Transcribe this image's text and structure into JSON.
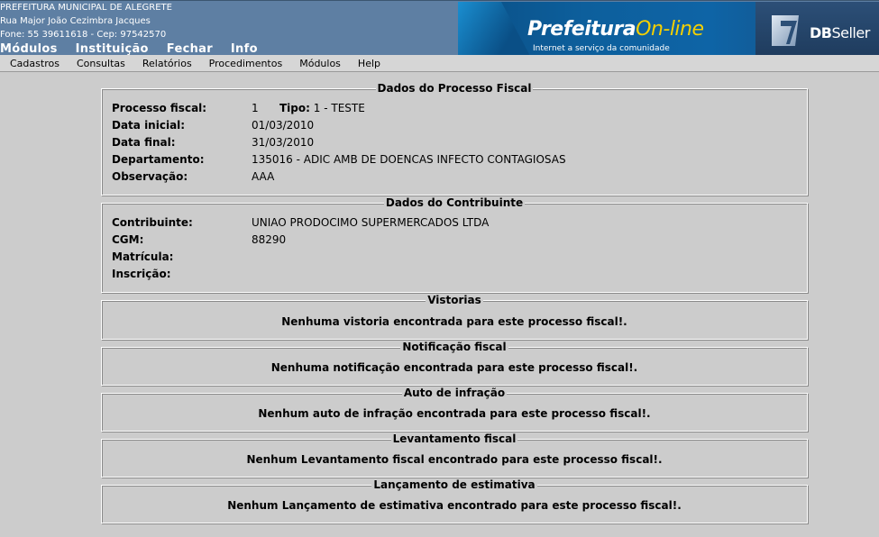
{
  "header": {
    "org_name": "PREFEITURA MUNICIPAL DE ALEGRETE",
    "address": "Rua Major João Cezimbra Jacques",
    "phone": "Fone: 55 39611618  -  Cep: 97542570",
    "menu": [
      "Módulos",
      "Instituição",
      "Fechar",
      "Info"
    ],
    "brand_prefix": "Prefeitura",
    "brand_suffix": "On-line",
    "brand_tagline": "Internet a serviço da comunidade",
    "dbseller_db": "DB",
    "dbseller_seller": "Seller"
  },
  "menubar": [
    "Cadastros",
    "Consultas",
    "Relatórios",
    "Procedimentos",
    "Módulos",
    "Help"
  ],
  "processo": {
    "legend": "Dados do Processo Fiscal",
    "processo_label": "Processo fiscal:",
    "processo_value": "1",
    "tipo_label": "Tipo:",
    "tipo_value": "1 - TESTE",
    "data_inicial_label": "Data inicial:",
    "data_inicial_value": "01/03/2010",
    "data_final_label": "Data final:",
    "data_final_value": "31/03/2010",
    "departamento_label": "Departamento:",
    "departamento_value": "135016 - ADIC AMB DE DOENCAS INFECTO CONTAGIOSAS",
    "observacao_label": "Observação:",
    "observacao_value": "AAA"
  },
  "contribuinte": {
    "legend": "Dados do Contribuinte",
    "contribuinte_label": "Contribuinte:",
    "contribuinte_value": "UNIAO PRODOCIMO SUPERMERCADOS LTDA",
    "cgm_label": "CGM:",
    "cgm_value": "88290",
    "matricula_label": "Matrícula:",
    "inscricao_label": "Inscrição:"
  },
  "vistorias": {
    "legend": "Vistorias",
    "message": "Nenhuma vistoria encontrada para este processo fiscal!."
  },
  "notificacao": {
    "legend": "Notificação fiscal",
    "message": "Nenhuma notificação encontrada para este processo fiscal!."
  },
  "auto": {
    "legend": "Auto de infração",
    "message": "Nenhum auto de infração encontrada para este processo fiscal!."
  },
  "levantamento": {
    "legend": "Levantamento fiscal",
    "message": "Nenhum Levantamento fiscal encontrado para este processo fiscal!."
  },
  "lancamento": {
    "legend": "Lançamento de estimativa",
    "message": "Nenhum Lançamento de estimativa encontrado para este processo fiscal!."
  }
}
